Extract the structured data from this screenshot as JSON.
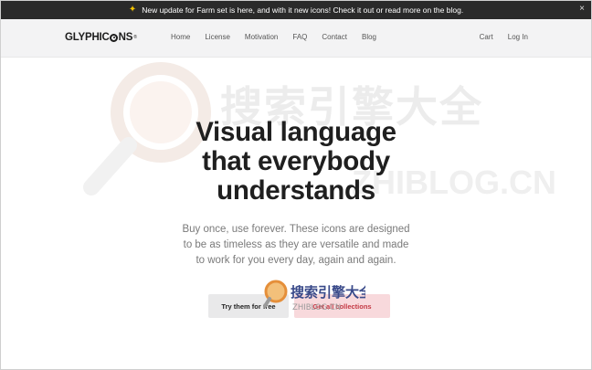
{
  "announcement": {
    "text": "New update for Farm set is here, and with it new icons! Check it out or read more on the blog.",
    "close_glyph": "×"
  },
  "brand": {
    "logo_before": "GLYPHIC",
    "logo_after": "NS",
    "registered": "®"
  },
  "nav": {
    "links": [
      "Home",
      "License",
      "Motivation",
      "FAQ",
      "Contact",
      "Blog"
    ],
    "cart": "Cart",
    "login": "Log In"
  },
  "hero": {
    "headline_line1": "Visual language",
    "headline_line2": "that everybody",
    "headline_line3": "understands",
    "subtext_line1": "Buy once, use forever. These icons are designed",
    "subtext_line2": "to be as timeless as they are versatile and made",
    "subtext_line3": "to work for you every day, again and again."
  },
  "buttons": {
    "try_free": "Try them for free",
    "get_collections": "Get all collections"
  },
  "watermark": {
    "big_text": "搜索引擎大全",
    "domain_text": "ZHIBLOG.CN",
    "small_text": "搜索引擎大全",
    "small_domain": "ZHIBLOG.CN"
  },
  "colors": {
    "announce_bg": "#2a2a2a",
    "nav_bg": "#f3f3f4",
    "accent_red": "#c43a45",
    "cta_bg": "#f8d9dc"
  }
}
